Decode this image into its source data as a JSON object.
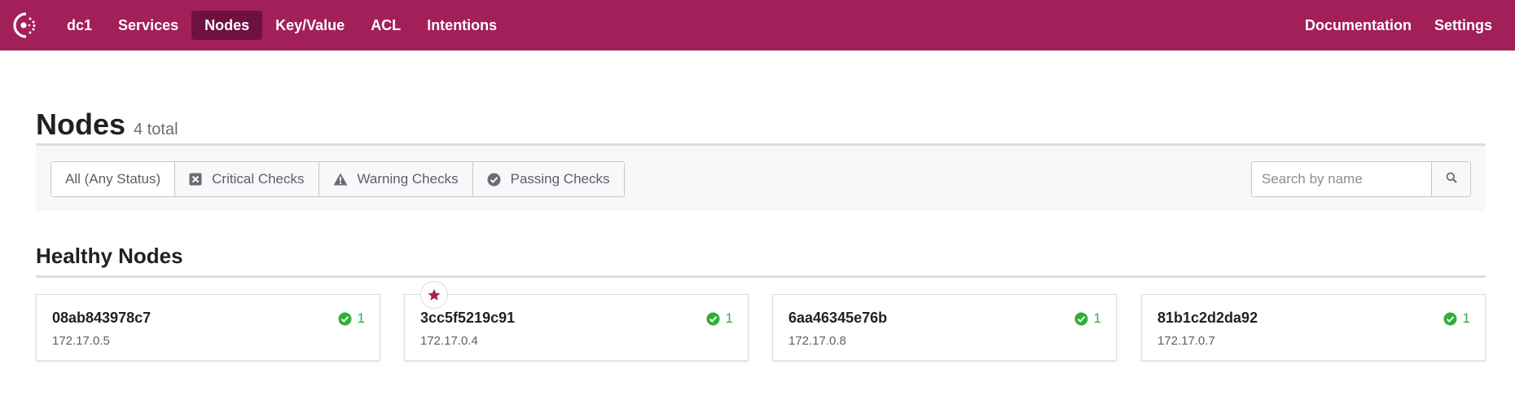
{
  "nav": {
    "datacenter": "dc1",
    "items": [
      {
        "label": "Services"
      },
      {
        "label": "Nodes"
      },
      {
        "label": "Key/Value"
      },
      {
        "label": "ACL"
      },
      {
        "label": "Intentions"
      }
    ],
    "active": "Nodes",
    "right_items": [
      {
        "label": "Documentation"
      },
      {
        "label": "Settings"
      }
    ]
  },
  "page": {
    "title": "Nodes",
    "count": "4 total"
  },
  "filters": {
    "buttons": [
      {
        "label": "All (Any Status)",
        "icon": null
      },
      {
        "label": "Critical Checks",
        "icon": "critical-x-icon"
      },
      {
        "label": "Warning Checks",
        "icon": "warning-triangle-icon"
      },
      {
        "label": "Passing Checks",
        "icon": "passing-check-icon"
      }
    ]
  },
  "search": {
    "placeholder": "Search by name",
    "value": ""
  },
  "section": {
    "title": "Healthy Nodes"
  },
  "nodes": [
    {
      "name": "08ab843978c7",
      "ip": "172.17.0.5",
      "checks": "1",
      "leader": false
    },
    {
      "name": "3cc5f5219c91",
      "ip": "172.17.0.4",
      "checks": "1",
      "leader": true
    },
    {
      "name": "6aa46345e76b",
      "ip": "172.17.0.8",
      "checks": "1",
      "leader": false
    },
    {
      "name": "81b1c2d2da92",
      "ip": "172.17.0.7",
      "checks": "1",
      "leader": false
    }
  ],
  "colors": {
    "brand": "#a31f59",
    "brand_active": "#6f1140",
    "passing": "#2eb039"
  }
}
